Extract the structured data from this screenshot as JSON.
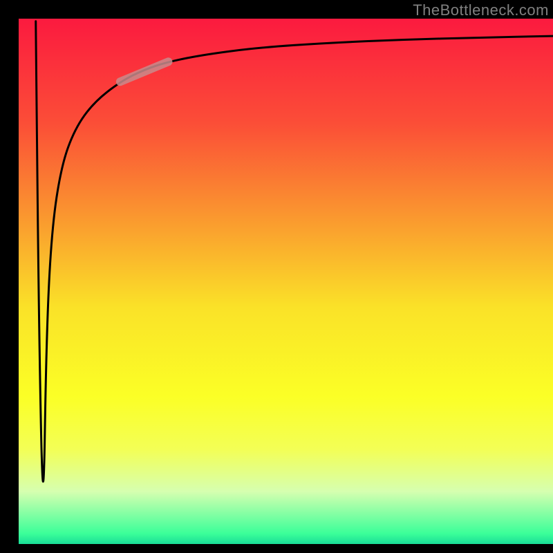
{
  "watermark": "TheBottleneck.com",
  "chart_data": {
    "type": "line",
    "title": "",
    "xlabel": "",
    "ylabel": "",
    "xlim": [
      0,
      100
    ],
    "ylim": [
      0,
      100
    ],
    "series": [
      {
        "name": "rainbow-gradient-background",
        "type": "gradient",
        "stops": [
          {
            "offset": 0.0,
            "color": "#fb1a3f"
          },
          {
            "offset": 0.2,
            "color": "#fb4e37"
          },
          {
            "offset": 0.4,
            "color": "#faa12e"
          },
          {
            "offset": 0.55,
            "color": "#fae228"
          },
          {
            "offset": 0.72,
            "color": "#fbff26"
          },
          {
            "offset": 0.82,
            "color": "#f3ff56"
          },
          {
            "offset": 0.9,
            "color": "#d6ffb0"
          },
          {
            "offset": 0.98,
            "color": "#3bff99"
          },
          {
            "offset": 1.0,
            "color": "#19dd97"
          }
        ]
      },
      {
        "name": "bottleneck-curve",
        "type": "path",
        "color": "#000000",
        "x": [
          3.2,
          3.8,
          4.6,
          5.2,
          6.2,
          8.0,
          10.5,
          14.0,
          19.0,
          23.5,
          28.0,
          35.0,
          45.0,
          58.0,
          72.0,
          86.0,
          100.0
        ],
        "values": [
          99.5,
          40.0,
          2.5,
          40.0,
          60.0,
          72.0,
          79.0,
          84.0,
          88.0,
          90.3,
          91.8,
          93.2,
          94.5,
          95.4,
          96.0,
          96.4,
          96.7
        ]
      },
      {
        "name": "highlight-segment",
        "type": "segment",
        "color": "#c98b8c",
        "x1": 19.0,
        "y1": 88.0,
        "x2": 28.0,
        "y2": 91.8
      }
    ]
  }
}
